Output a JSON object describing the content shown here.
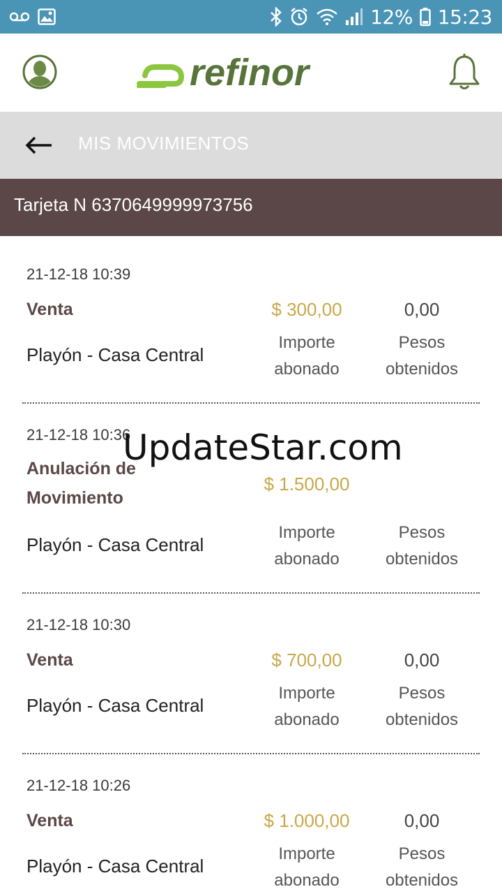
{
  "status_bar": {
    "battery": "12%",
    "time": "15:23",
    "icons": [
      "voicemail-icon",
      "image-icon",
      "bluetooth-icon",
      "alarm-icon",
      "wifi-icon",
      "signal-icon",
      "battery-icon"
    ]
  },
  "header": {
    "logo_text": "refinor",
    "brand_color": "#57743a",
    "accent_color": "#8cc63f"
  },
  "title_bar": {
    "title": "MIS MOVIMIENTOS"
  },
  "card": {
    "label": "Tarjeta N 6370649999973756"
  },
  "watermark": "UpdateStar.com",
  "movements": [
    {
      "date": "21-12-18 10:39",
      "type": "Venta",
      "amount": "$ 300,00",
      "points": "0,00",
      "place": "Playón - Casa Central",
      "amount_label_1": "Importe",
      "amount_label_2": "abonado",
      "points_label_1": "Pesos",
      "points_label_2": "obtenidos"
    },
    {
      "date": "21-12-18 10:36",
      "type": "Anulación de Movimiento",
      "amount": "$ 1.500,00",
      "points": "",
      "place": "Playón - Casa Central",
      "amount_label_1": "Importe",
      "amount_label_2": "abonado",
      "points_label_1": "Pesos",
      "points_label_2": "obtenidos"
    },
    {
      "date": "21-12-18 10:30",
      "type": "Venta",
      "amount": "$ 700,00",
      "points": "0,00",
      "place": "Playón - Casa Central",
      "amount_label_1": "Importe",
      "amount_label_2": "abonado",
      "points_label_1": "Pesos",
      "points_label_2": "obtenidos"
    },
    {
      "date": "21-12-18 10:26",
      "type": "Venta",
      "amount": "$ 1.000,00",
      "points": "0,00",
      "place": "Playón - Casa Central",
      "amount_label_1": "Importe",
      "amount_label_2": "abonado",
      "points_label_1": "Pesos",
      "points_label_2": "obtenidos"
    }
  ]
}
